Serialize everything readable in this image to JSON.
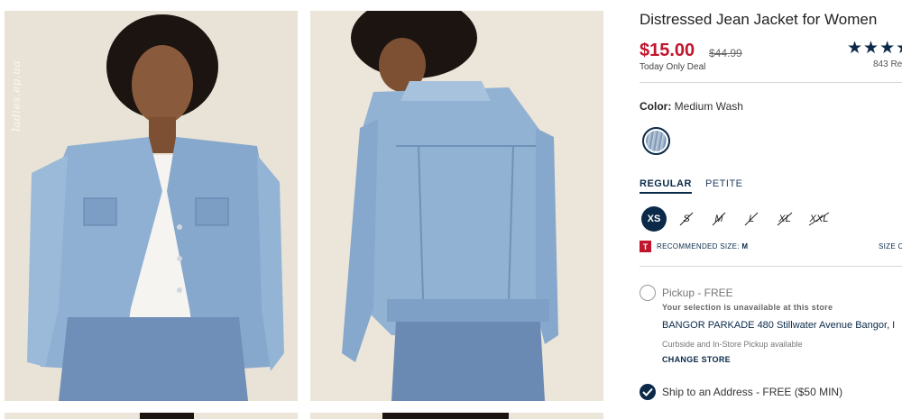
{
  "product": {
    "title": "Distressed Jean Jacket for Women",
    "price": "$15.00",
    "original_price": "$44.99",
    "deal_label": "Today Only Deal",
    "rating_stars": "★★★★",
    "review_count": "843 Re"
  },
  "gallery": {
    "watermark": "ladies.ep.ua",
    "images": [
      "front view",
      "back view"
    ]
  },
  "color": {
    "label": "Color:",
    "value": "Medium Wash",
    "swatch_color": "#8ea6c0"
  },
  "fit_tabs": [
    {
      "label": "REGULAR",
      "selected": true
    },
    {
      "label": "PETITE",
      "selected": false
    }
  ],
  "sizes": [
    {
      "label": "XS",
      "available": true,
      "selected": true
    },
    {
      "label": "S",
      "available": false
    },
    {
      "label": "M",
      "available": false
    },
    {
      "label": "L",
      "available": false
    },
    {
      "label": "XL",
      "available": false
    },
    {
      "label": "XXL",
      "available": false
    }
  ],
  "recommendation": {
    "icon": "T",
    "label": "RECOMMENDED SIZE:",
    "value": "M",
    "size_chart": "SIZE C"
  },
  "fulfillment": {
    "pickup_label": "Pickup - FREE",
    "unavailable_text": "Your selection is unavailable at this store",
    "store_name": "BANGOR PARKADE",
    "store_address": "480 Stillwater Avenue  Bangor, I",
    "curbside_text": "Curbside and In-Store Pickup available",
    "change_store": "CHANGE STORE",
    "ship_label": "Ship to an Address - FREE ($50 MIN)"
  },
  "colors": {
    "brand_navy": "#0b2a4a",
    "sale_red": "#c0152c"
  }
}
